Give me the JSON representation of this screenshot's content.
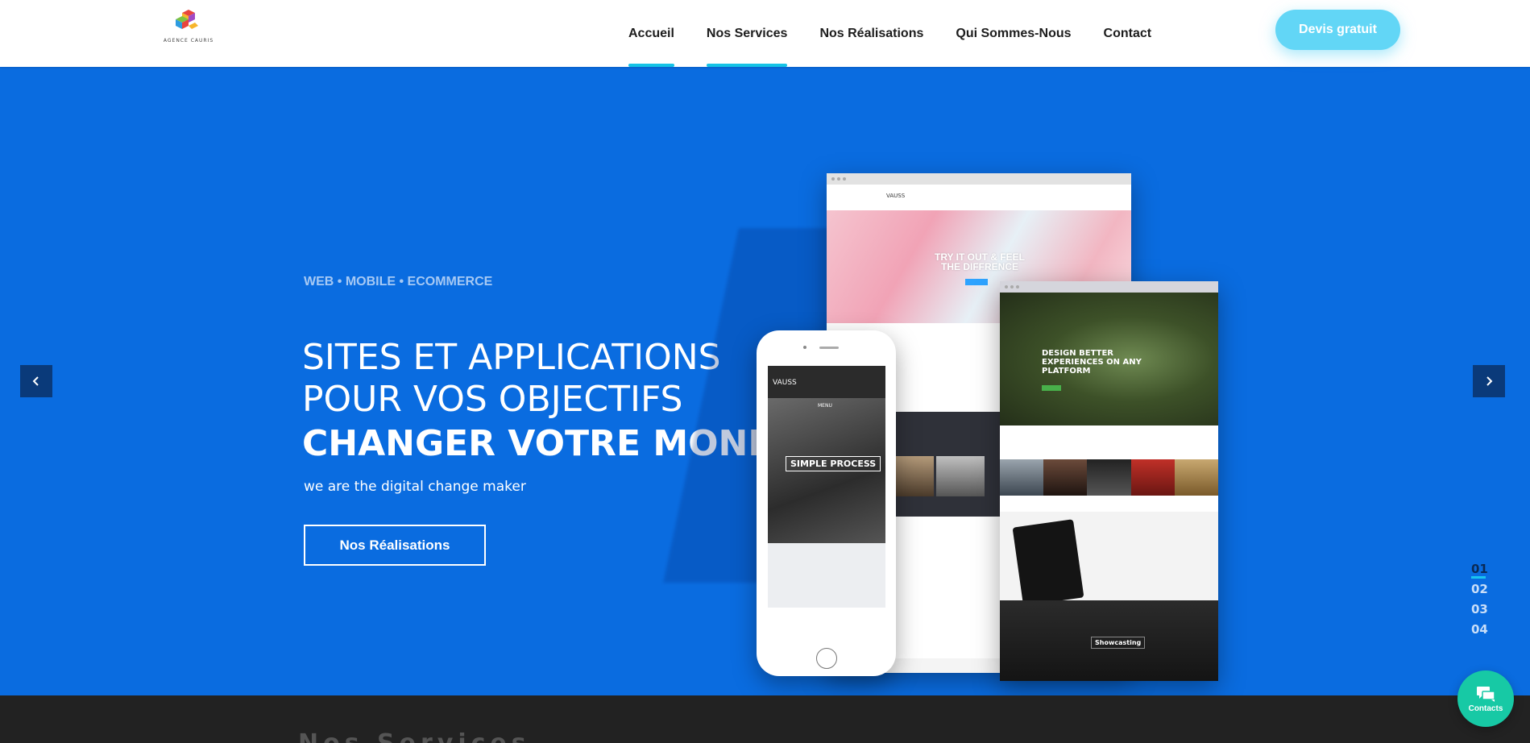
{
  "brand": {
    "logo_text": "AGENCE CAURIS",
    "logo_colors": [
      "#e8443c",
      "#f7b52c",
      "#7cc243",
      "#2d9be0",
      "#a14bc5"
    ]
  },
  "nav": {
    "items": [
      {
        "label": "Accueil",
        "active": true
      },
      {
        "label": "Nos Services",
        "active": true
      },
      {
        "label": "Nos Réalisations",
        "active": false
      },
      {
        "label": "Qui Sommes-Nous",
        "active": false
      },
      {
        "label": "Contact",
        "active": false
      }
    ],
    "cta_label": "Devis gratuit"
  },
  "hero": {
    "kicker": "WEB • MOBILE • ECOMMERCE",
    "line1": "SITES ET APPLICATIONS",
    "line2": "POUR VOS OBJECTIFS",
    "line3": "CHANGER VOTRE MONDE",
    "tagline": "we are the digital change maker",
    "button_label": "Nos Réalisations",
    "background": "#0a6ce0",
    "mockup_texts": {
      "back_title": "VAUSS",
      "back_headline": "TRY IT OUT & FEEL THE DIFFRENCE",
      "front_headline": "DESIGN BETTER EXPERIENCES ON ANY PLATFORM",
      "front_bottom": "Showcasting",
      "phone_title": "VAUSS",
      "phone_menu": "MENU",
      "phone_label": "SIMPLE PROCESS"
    }
  },
  "slider": {
    "pages": [
      "01",
      "02",
      "03",
      "04"
    ],
    "active_index": 0
  },
  "next_section": {
    "title": "Nos Services"
  },
  "contacts": {
    "label": "Contacts"
  },
  "colors": {
    "accent": "#15c3e6",
    "cta": "#62d6f6",
    "contacts": "#17c9a5",
    "arrow_bg": "#0a3a7a"
  }
}
